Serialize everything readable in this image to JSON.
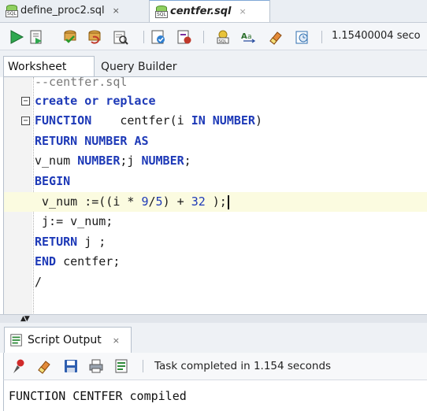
{
  "editor_tabs": [
    {
      "name": "define_proc2.sql",
      "close": "×",
      "active": false
    },
    {
      "name": "centfer.sql",
      "close": "×",
      "active": true
    }
  ],
  "toolbar": {
    "execution_time": "1.15400004 seco",
    "icons": [
      "run-statement-icon",
      "run-script-icon",
      "commit-icon",
      "rollback-icon",
      "autotrace-icon",
      "explain-plan-icon",
      "sql-tuning-icon",
      "dbms-output-icon",
      "to-upper-lower-icon",
      "clear-icon",
      "history-icon"
    ]
  },
  "worksheet_tabs": {
    "worksheet": "Worksheet",
    "query_builder": "Query Builder"
  },
  "code_lines": [
    {
      "segments": [
        {
          "t": "--centfer.sql",
          "c": "cmt"
        }
      ]
    },
    {
      "fold": "−",
      "segments": [
        {
          "t": "create or replace",
          "c": "kw"
        }
      ]
    },
    {
      "fold": "−",
      "segments": [
        {
          "t": "FUNCTION",
          "c": "kw"
        },
        {
          "t": "    centfer(i ",
          "c": ""
        },
        {
          "t": "IN",
          "c": "kw"
        },
        {
          "t": " ",
          "c": ""
        },
        {
          "t": "NUMBER",
          "c": "kw"
        },
        {
          "t": ")",
          "c": ""
        }
      ]
    },
    {
      "segments": [
        {
          "t": "RETURN",
          "c": "kw"
        },
        {
          "t": " ",
          "c": ""
        },
        {
          "t": "NUMBER",
          "c": "kw"
        },
        {
          "t": " ",
          "c": ""
        },
        {
          "t": "AS",
          "c": "kw"
        }
      ]
    },
    {
      "segments": [
        {
          "t": "v_num ",
          "c": ""
        },
        {
          "t": "NUMBER",
          "c": "kw"
        },
        {
          "t": ";j ",
          "c": ""
        },
        {
          "t": "NUMBER",
          "c": "kw"
        },
        {
          "t": ";",
          "c": ""
        }
      ]
    },
    {
      "segments": [
        {
          "t": "BEGIN",
          "c": "kw"
        }
      ]
    },
    {
      "highlight": true,
      "caret": true,
      "segments": [
        {
          "t": " v_num :=((i * ",
          "c": ""
        },
        {
          "t": "9",
          "c": "num"
        },
        {
          "t": "/",
          "c": ""
        },
        {
          "t": "5",
          "c": "num"
        },
        {
          "t": ") + ",
          "c": ""
        },
        {
          "t": "32",
          "c": "num"
        },
        {
          "t": " );",
          "c": ""
        }
      ]
    },
    {
      "segments": [
        {
          "t": " j:= v_num;",
          "c": ""
        }
      ]
    },
    {
      "segments": [
        {
          "t": "RETURN",
          "c": "kw"
        },
        {
          "t": " j ;",
          "c": ""
        }
      ]
    },
    {
      "segments": [
        {
          "t": "END",
          "c": "kw"
        },
        {
          "t": " centfer;",
          "c": ""
        }
      ]
    },
    {
      "segments": [
        {
          "t": "/",
          "c": ""
        }
      ]
    }
  ],
  "output": {
    "tab_label": "Script Output",
    "tab_close": "×",
    "status": "Task completed in 1.154 seconds",
    "text": "FUNCTION CENTFER compiled",
    "icons": [
      "pin-icon",
      "clear-output-icon",
      "save-icon",
      "print-icon",
      "open-icon"
    ]
  }
}
